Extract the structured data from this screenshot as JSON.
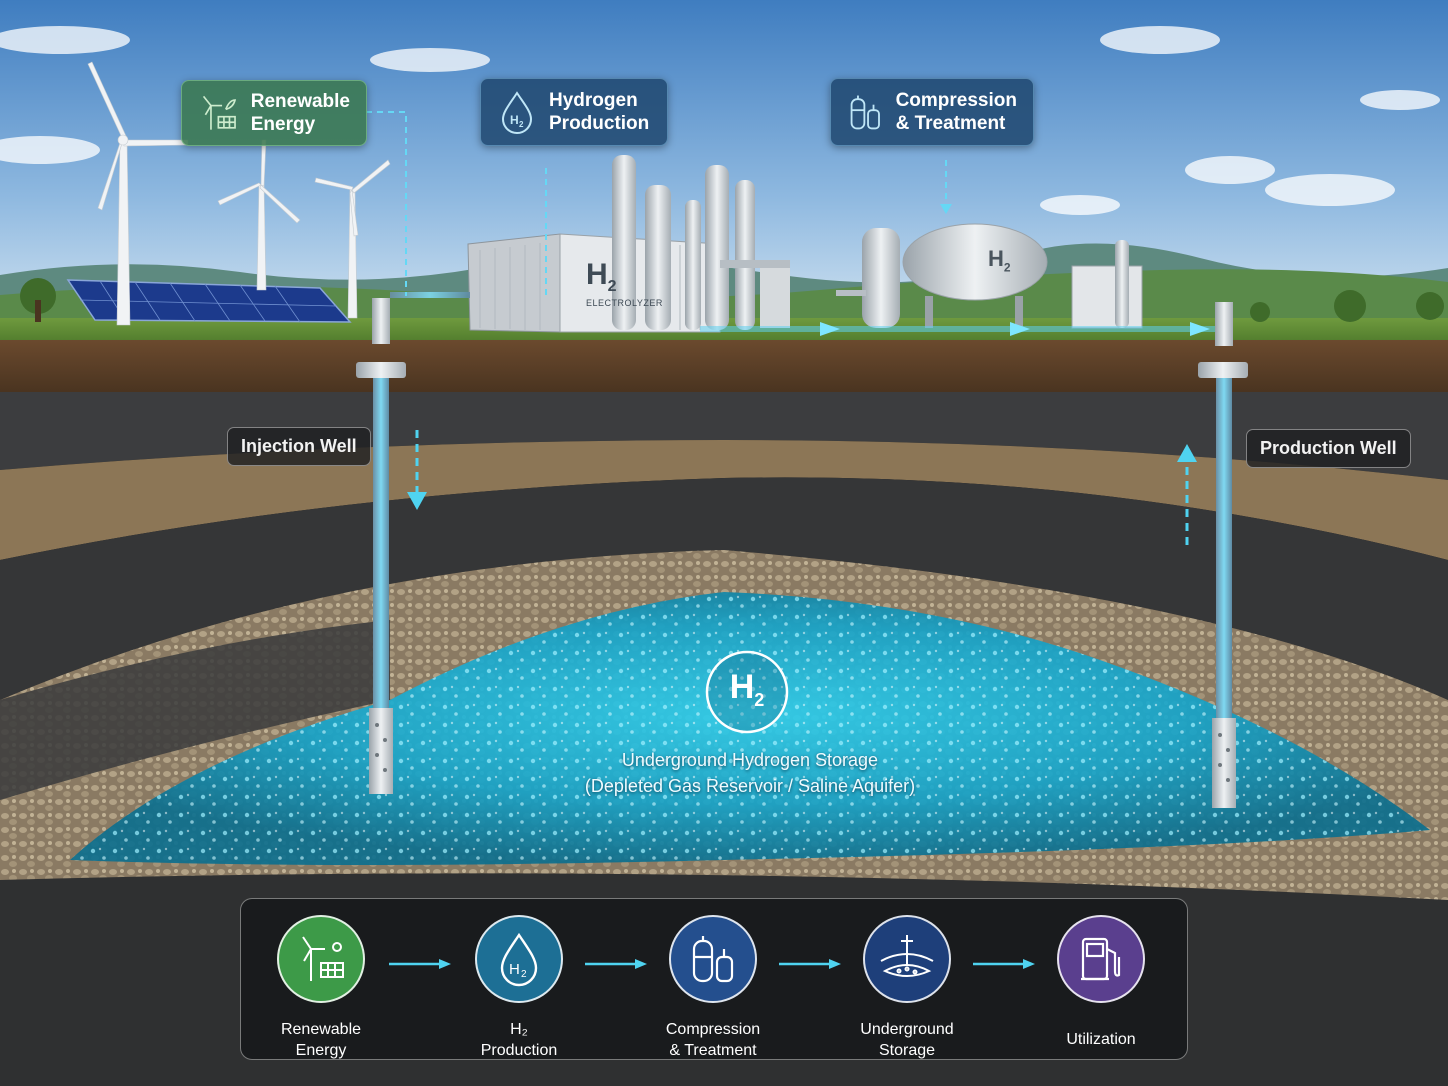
{
  "labels": {
    "renewable": [
      "Renewable",
      "Energy"
    ],
    "hydrogen": [
      "Hydrogen",
      "Production"
    ],
    "compression": [
      "Compression",
      "& Treatment"
    ],
    "injection_well": "Injection Well",
    "production_well": "Production Well",
    "electrolyzer_h2": "H",
    "electrolyzer_sub": "2",
    "electrolyzer_name": "ELECTROLYZER",
    "tank_h2": "H",
    "tank_sub": "2"
  },
  "storage": {
    "symbol": "H",
    "symbol_sub": "2",
    "title": "Underground Hydrogen Storage",
    "subtitle": "(Depleted Gas Reservoir / Saline Aquifer)"
  },
  "flow_steps": [
    {
      "line1": "Renewable",
      "line2": "Energy",
      "icon": "wind-solar-icon",
      "color": "#3d9a48"
    },
    {
      "line1": "H₂",
      "line2": "Production",
      "icon": "h2-drop-icon",
      "color": "#1d6f95"
    },
    {
      "line1": "Compression",
      "line2": "& Treatment",
      "icon": "tanks-icon",
      "color": "#244f8e"
    },
    {
      "line1": "Underground",
      "line2": "Storage",
      "icon": "underground-storage-icon",
      "color": "#1e3f7a"
    },
    {
      "line1": "Utilization",
      "line2": "",
      "icon": "fuel-pump-icon",
      "color": "#5a3f8e"
    }
  ],
  "colors": {
    "sky_top": "#4d86c6",
    "sky_bottom": "#cfe2f2",
    "hydrogen_glow": "#27c4e6",
    "arrow": "#4fd3f0"
  }
}
